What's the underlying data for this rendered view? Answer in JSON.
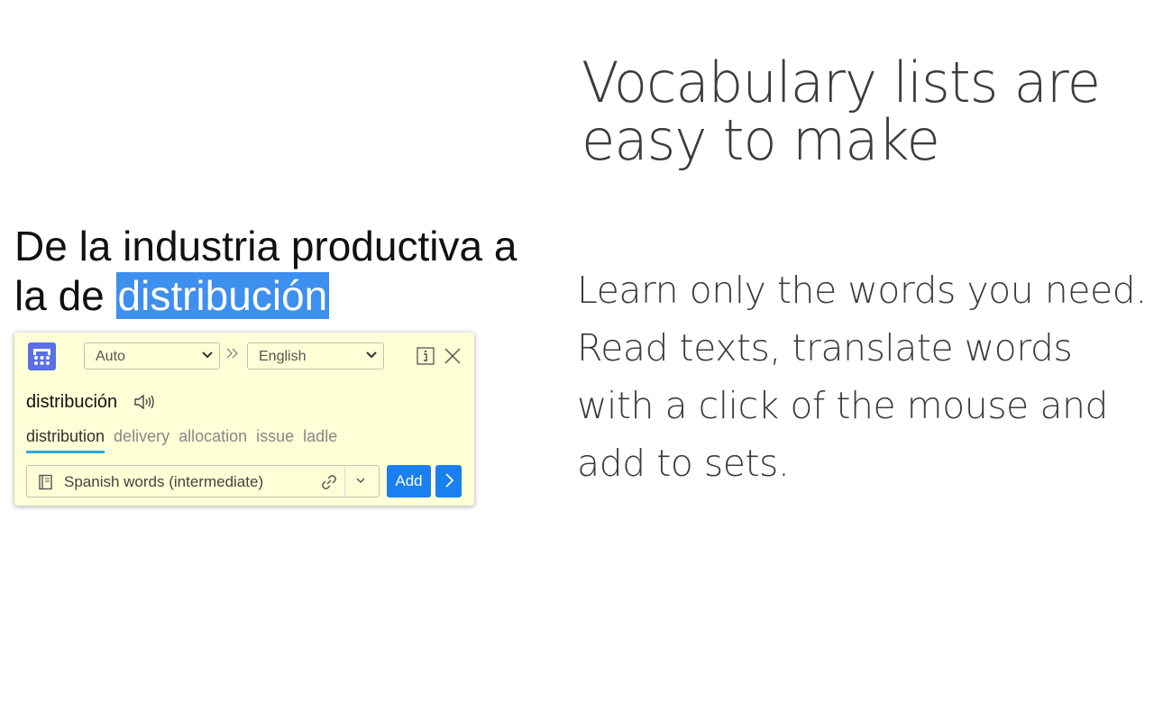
{
  "headline": "Vocabulary lists are easy to make",
  "description": "Learn only the words you need. Read texts, translate words with a click of the mouse and add to sets.",
  "sentence": {
    "before": "De la industria productiva a la de ",
    "highlighted": "distribución"
  },
  "popup": {
    "source_language": "Auto",
    "target_language": "English",
    "word": "distribución",
    "translations": [
      "distribution",
      "delivery",
      "allocation",
      "issue",
      "ladle"
    ],
    "set_name": "Spanish words (intermediate)",
    "add_label": "Add",
    "colors": {
      "background": "#fffed6",
      "accent": "#1a7ff0",
      "logo": "#5970e8",
      "highlight": "#3d8ff0"
    }
  }
}
